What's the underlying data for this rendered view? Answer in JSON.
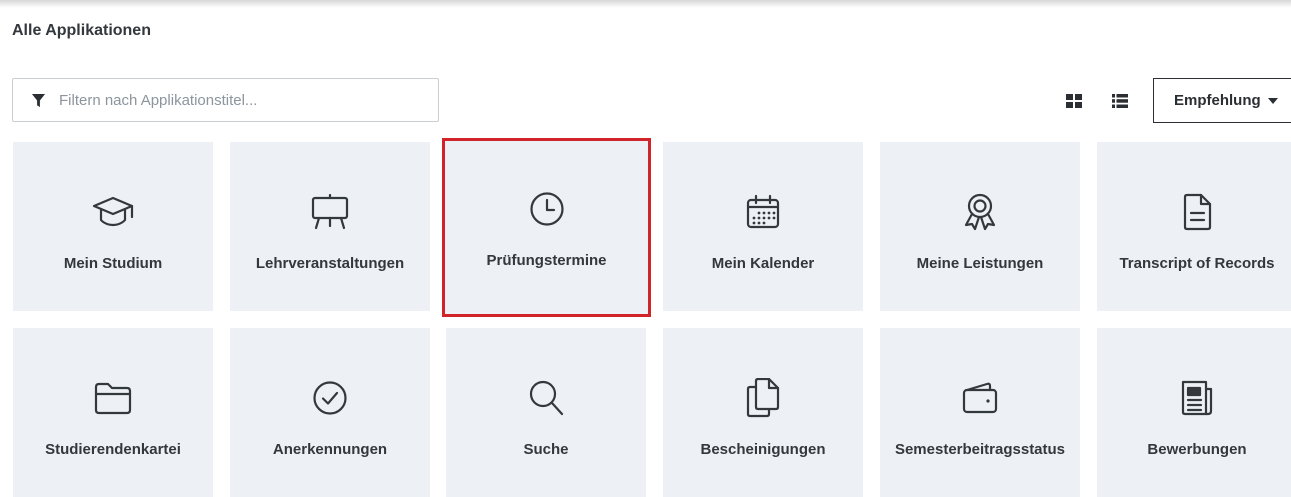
{
  "page": {
    "title": "Alle Applikationen"
  },
  "filter": {
    "placeholder": "Filtern nach Applikationstitel...",
    "value": ""
  },
  "toolbar": {
    "view_grid_icon": "grid-view-icon",
    "view_list_icon": "list-view-icon",
    "sort_label": "Empfehlung"
  },
  "colors": {
    "tile_background": "#edf1f5",
    "highlight_border": "#d0232a",
    "text": "#33383d"
  },
  "apps": [
    {
      "label": "Mein Studium",
      "icon": "graduation-cap-icon",
      "highlighted": false
    },
    {
      "label": "Lehrveranstaltungen",
      "icon": "easel-icon",
      "highlighted": false
    },
    {
      "label": "Prüfungstermine",
      "icon": "clock-icon",
      "highlighted": true
    },
    {
      "label": "Mein Kalender",
      "icon": "calendar-icon",
      "highlighted": false
    },
    {
      "label": "Meine Leistungen",
      "icon": "award-ribbon-icon",
      "highlighted": false
    },
    {
      "label": "Transcript of Records",
      "icon": "document-icon",
      "highlighted": false
    },
    {
      "label": "Studierendenkartei",
      "icon": "folder-icon",
      "highlighted": false
    },
    {
      "label": "Anerkennungen",
      "icon": "check-circle-icon",
      "highlighted": false
    },
    {
      "label": "Suche",
      "icon": "search-icon",
      "highlighted": false
    },
    {
      "label": "Bescheinigungen",
      "icon": "copy-documents-icon",
      "highlighted": false
    },
    {
      "label": "Semesterbeitragsstatus",
      "icon": "wallet-icon",
      "highlighted": false
    },
    {
      "label": "Bewerbungen",
      "icon": "newspaper-icon",
      "highlighted": false
    }
  ]
}
